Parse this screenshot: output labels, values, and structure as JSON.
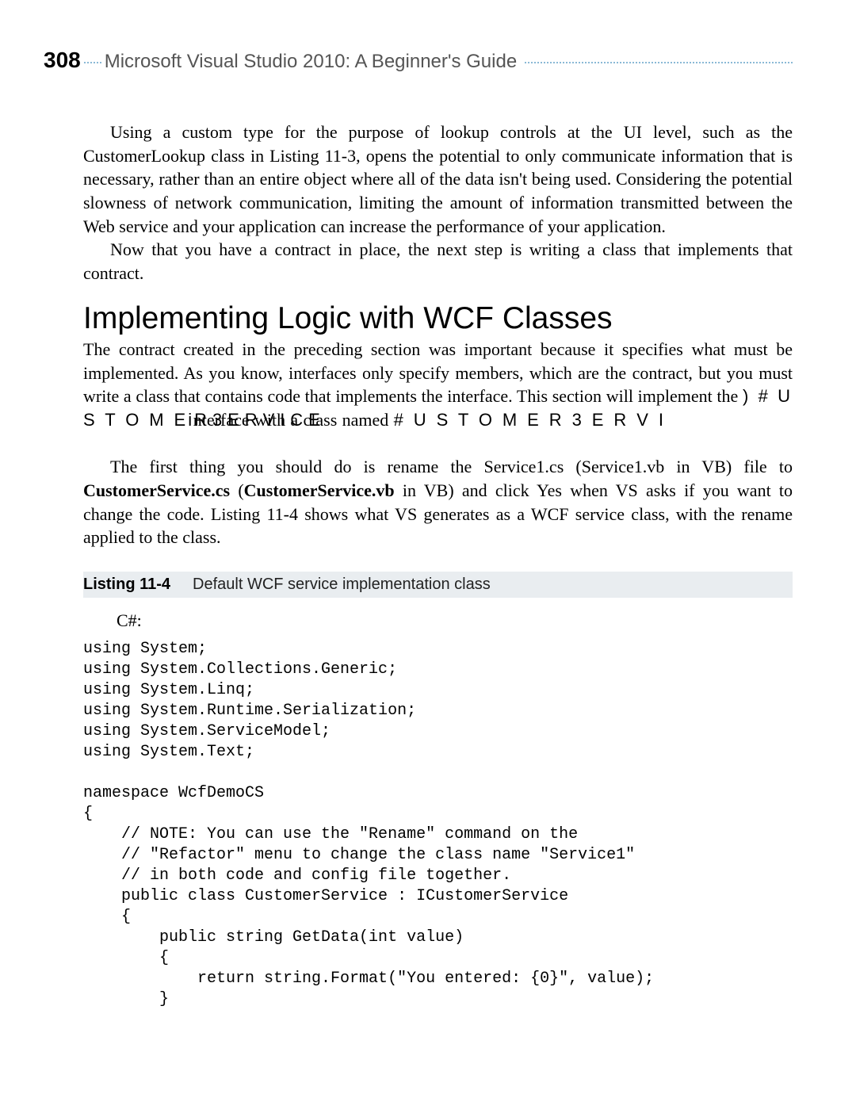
{
  "header": {
    "page_number": "308",
    "book_title": "Microsoft Visual Studio 2010: A Beginner's Guide"
  },
  "para1_a": "Using a custom type for the purpose of lookup controls at the UI level, such as the CustomerLookup class in Listing 11-3, opens the potential to only communicate information that is necessary, rather than an entire object where all of the data isn't being used. Considering the potential slowness of network communication, limiting the amount of information transmitted between the Web service and your application can increase the performance of your application.",
  "para1_b": "Now that you have a contract in place, the next step is writing a class that implements that contract.",
  "section_heading": "Implementing Logic with WCF Classes",
  "para2": {
    "t1": "The contract created in the preceding section was important because it specifies what must be implemented. As you know, interfaces only specify members, which are the contract, but you must write a class that contains code that implements the interface. This section will implement the ",
    "c1": ") # U S T O M Ei",
    "t2": "nterface with a class named ",
    "c1b": "R 3 E R V I C E",
    "c2": "# U S T O M E R 3 E R V I C E"
  },
  "para3": {
    "t1": "The first thing you should do is rename the Service1.cs (Service1.vb in VB) file to ",
    "b1": "CustomerService.cs",
    "t2": " (",
    "b2": "CustomerService.vb",
    "t3": " in VB) and click Yes when VS asks if you want to change the code. Listing 11-4 shows what VS generates as a WCF service class, with the rename applied to the class."
  },
  "listing": {
    "label": "Listing 11-4",
    "caption": "Default WCF service implementation class"
  },
  "code": {
    "lang": "C#:",
    "body": "using System;\nusing System.Collections.Generic;\nusing System.Linq;\nusing System.Runtime.Serialization;\nusing System.ServiceModel;\nusing System.Text;\n\nnamespace WcfDemoCS\n{\n    // NOTE: You can use the \"Rename\" command on the\n    // \"Refactor\" menu to change the class name \"Service1\"\n    // in both code and config file together.\n    public class CustomerService : ICustomerService\n    {\n        public string GetData(int value)\n        {\n            return string.Format(\"You entered: {0}\", value);\n        }"
  }
}
